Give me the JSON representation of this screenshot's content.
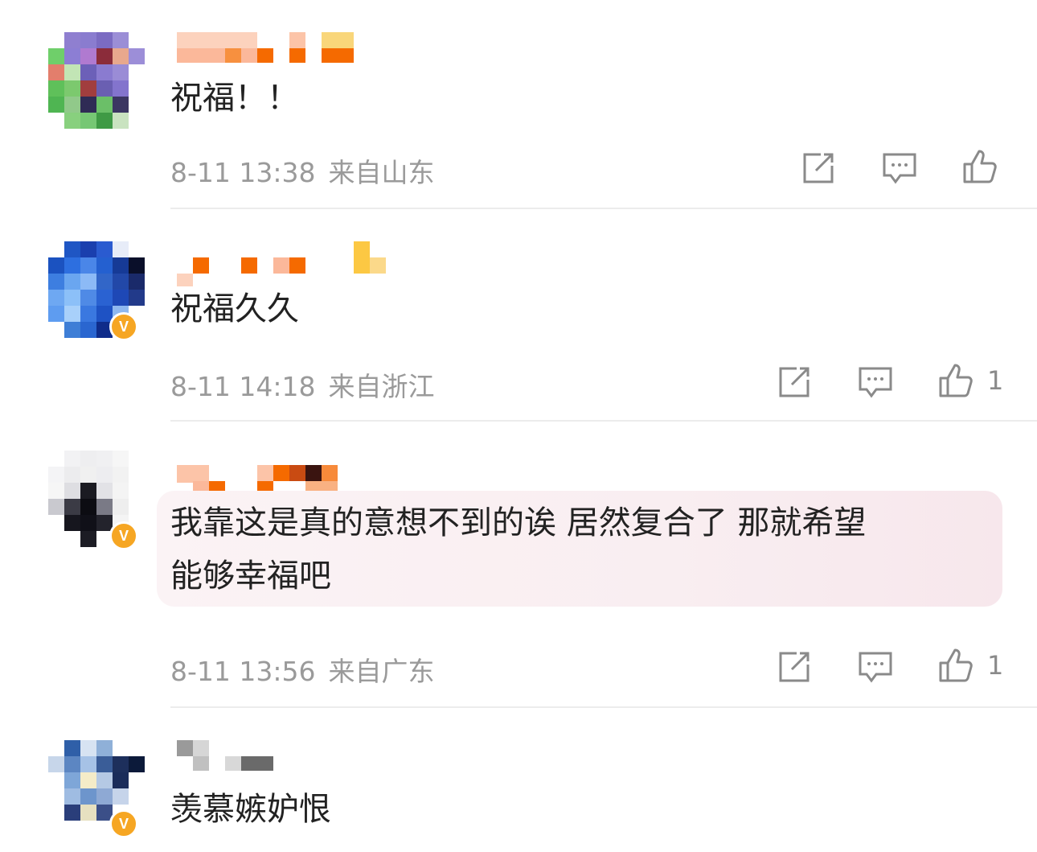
{
  "comments": [
    {
      "text": "祝福！！",
      "time": "8-11 13:38",
      "location": "来自山东",
      "likes": "",
      "verified": false
    },
    {
      "text": "祝福久久",
      "time": "8-11 14:18",
      "location": "来自浙江",
      "likes": "1",
      "verified": true
    },
    {
      "text_line1": "我靠这是真的意想不到的诶 居然复合了 那就希望",
      "text_line2": "能够幸福吧",
      "time": "8-11 13:56",
      "location": "来自广东",
      "likes": "1",
      "verified": true,
      "highlighted": true
    },
    {
      "text": "羡慕嫉妒恨",
      "verified": true
    }
  ],
  "icons": {
    "share": "share-icon",
    "comment": "comment-icon",
    "like": "like-icon",
    "verified": "verified-badge-icon"
  },
  "colors": {
    "text": "#222222",
    "meta": "#9a9a9a",
    "verified": "#f6a623",
    "divider": "#ececec",
    "highlight_bg": "#f9eef1"
  }
}
